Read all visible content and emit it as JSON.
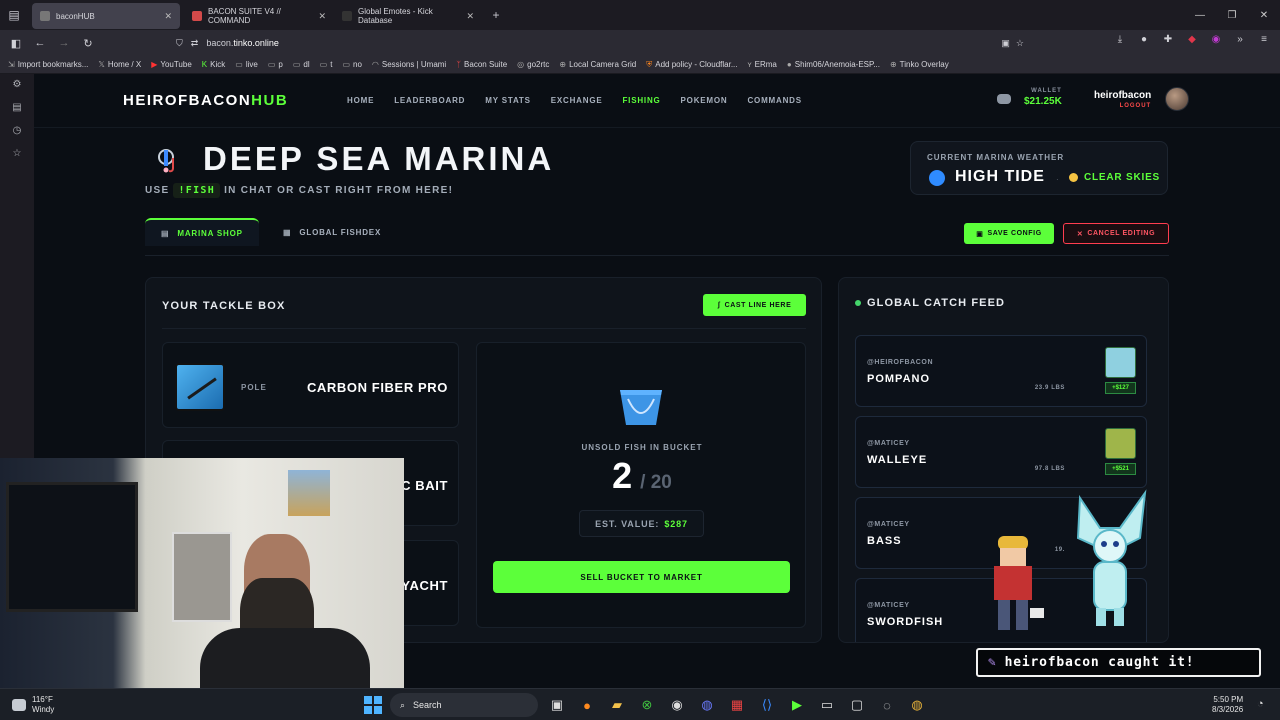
{
  "browser": {
    "tabs": [
      {
        "title": "baconHUB",
        "active": true
      },
      {
        "title": "BACON SUITE V4 // COMMAND",
        "active": false
      },
      {
        "title": "Global Emotes - Kick Database",
        "active": false
      }
    ],
    "new_tab": "+",
    "url_host": "bacon.",
    "url_domain": "tinko.online",
    "bookmarks": [
      "Import bookmarks...",
      "Home / X",
      "YouTube",
      "Kick",
      "live",
      "p",
      "dl",
      "t",
      "no",
      "Sessions | Umami",
      "Bacon Suite",
      "go2rtc",
      "Local Camera Grid",
      "Add policy - Cloudflar...",
      "ERma",
      "Shim06/Anemoia-ESP...",
      "Tinko Overlay"
    ]
  },
  "site": {
    "brand_main": "HEIROFBACON",
    "brand_accent": "HUB",
    "menu": [
      "HOME",
      "LEADERBOARD",
      "MY STATS",
      "EXCHANGE",
      "FISHING",
      "POKEMON",
      "COMMANDS"
    ],
    "active_menu": "FISHING",
    "wallet_label": "WALLET",
    "wallet_value": "$21.25K",
    "username": "heirofbacon",
    "logout": "LOGOUT"
  },
  "header": {
    "title": "DEEP SEA MARINA",
    "subtitle_pre": "USE",
    "subtitle_cmd": "!FISH",
    "subtitle_post": "IN CHAT OR CAST RIGHT FROM HERE!"
  },
  "weather": {
    "label": "CURRENT MARINA WEATHER",
    "tide": "HIGH TIDE",
    "separator": "·",
    "sky": "CLEAR SKIES"
  },
  "page_tabs": {
    "shop": "MARINA SHOP",
    "fishdex": "GLOBAL FISHDEX",
    "save": "SAVE CONFIG",
    "cancel": "CANCEL EDITING"
  },
  "tackle": {
    "title": "YOUR TACKLE BOX",
    "cast_button": "CAST LINE HERE",
    "items": [
      {
        "type": "POLE",
        "name": "CARBON FIBER PRO"
      },
      {
        "type": "",
        "name": "C BAIT"
      },
      {
        "type": "",
        "name": "YACHT"
      }
    ]
  },
  "bucket": {
    "label": "UNSOLD FISH IN BUCKET",
    "count": "2",
    "capacity": "/ 20",
    "est_label": "EST. VALUE:",
    "est_value": "$287",
    "sell_button": "SELL BUCKET TO MARKET"
  },
  "feed": {
    "title": "GLOBAL CATCH FEED",
    "items": [
      {
        "user": "@HEIROFBACON",
        "fish": "POMPANO",
        "weight": "23.9 LBS",
        "price": "+$127",
        "color": "#8fd0e0"
      },
      {
        "user": "@MATICEY",
        "fish": "WALLEYE",
        "weight": "97.8 LBS",
        "price": "+$521",
        "color": "#9fb54a"
      },
      {
        "user": "@MATICEY",
        "fish": "BASS",
        "weight": "19.",
        "price": "",
        "color": "#6aa24b"
      },
      {
        "user": "@MATICEY",
        "fish": "SWORDFISH",
        "weight": "",
        "price": "",
        "color": "#4a7fb5"
      }
    ]
  },
  "toast": {
    "text": "heirofbacon caught it!"
  },
  "taskbar": {
    "temp": "116°F",
    "condition": "Windy",
    "search": "Search",
    "time": "5:50 PM",
    "date": "8/3/2026"
  }
}
